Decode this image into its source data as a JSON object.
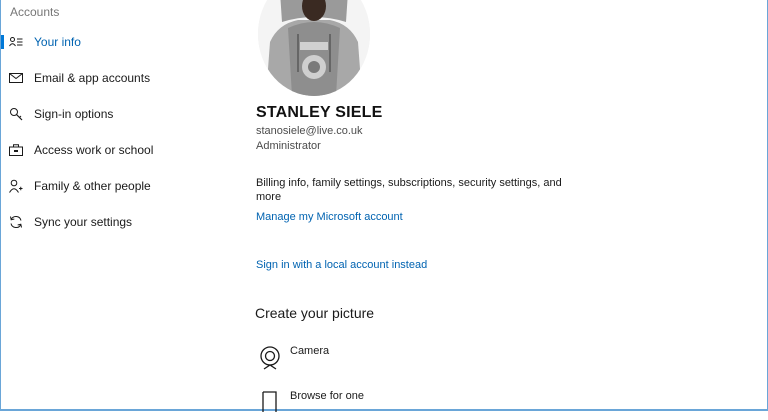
{
  "sidebar": {
    "section_title": "Accounts",
    "items": [
      {
        "label": "Your info",
        "icon": "user-card-icon",
        "active": true
      },
      {
        "label": "Email & app accounts",
        "icon": "mail-icon"
      },
      {
        "label": "Sign-in options",
        "icon": "key-icon"
      },
      {
        "label": "Access work or school",
        "icon": "briefcase-icon"
      },
      {
        "label": "Family & other people",
        "icon": "person-plus-icon"
      },
      {
        "label": "Sync your settings",
        "icon": "sync-icon"
      }
    ]
  },
  "profile": {
    "name": "STANLEY SIELE",
    "email": "stanosiele@live.co.uk",
    "role": "Administrator",
    "billing_text": "Billing info, family settings, subscriptions, security settings, and more",
    "manage_link": "Manage my Microsoft account",
    "local_account_link": "Sign in with a local account instead"
  },
  "create_picture": {
    "heading": "Create your picture",
    "options": [
      {
        "label": "Camera",
        "icon": "camera-icon"
      },
      {
        "label": "Browse for one",
        "icon": "browse-icon"
      }
    ]
  },
  "colors": {
    "accent": "#0078d7",
    "link": "#0063b1",
    "frame": "#6aa6d8"
  }
}
